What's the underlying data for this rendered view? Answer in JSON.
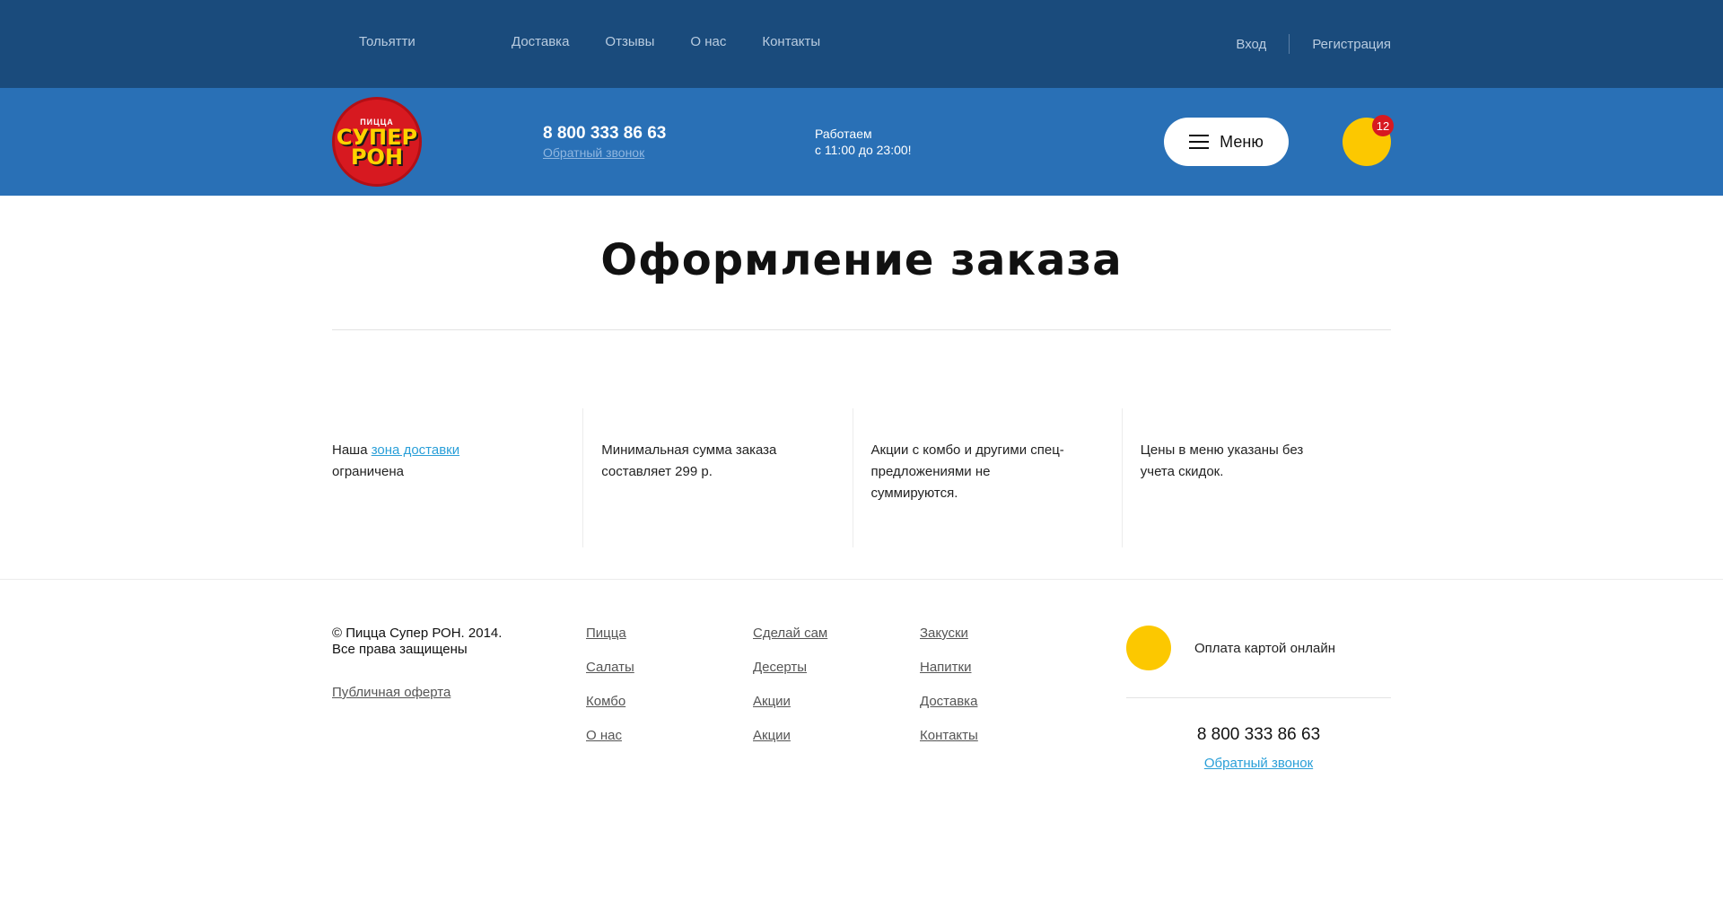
{
  "topbar": {
    "city": "Тольятти",
    "nav": [
      "Доставка",
      "Отзывы",
      "О нас",
      "Контакты"
    ],
    "login": "Вход",
    "register": "Регистрация"
  },
  "header": {
    "logo_small": "ПИЦЦА",
    "logo_big_1": "СУПЕР",
    "logo_big_2": "РОН",
    "phone": "8 800 333 86 63",
    "callback": "Обратный звонок",
    "hours_line1": "Работаем",
    "hours_line2": "с 11:00 до 23:00!",
    "menu_label": "Меню",
    "cart_count": "12"
  },
  "page": {
    "title": "Оформление заказа"
  },
  "info": {
    "col1_prefix": "Наша ",
    "col1_link": "зона доставки",
    "col1_suffix": " ограничена",
    "col2": "Минимальная сумма заказа составляет 299 р.",
    "col3": "Акции с комбо и другими спец-предложениями не суммируются.",
    "col4": "Цены в меню указаны без учета скидок."
  },
  "footer": {
    "copy_line1": "© Пицца Супер РОН. 2014.",
    "copy_line2": "Все права защищены",
    "offer": "Публичная оферта",
    "col1": [
      "Пицца",
      "Салаты",
      "Комбо",
      "О нас"
    ],
    "col2": [
      "Сделай сам",
      "Десерты",
      "Акции",
      "Акции"
    ],
    "col3": [
      "Закуски",
      "Напитки",
      "Доставка",
      "Контакты"
    ],
    "pay_label": "Оплата картой онлайн",
    "phone": "8 800 333 86 63",
    "callback": "Обратный звонок"
  },
  "colors": {
    "topbar_bg": "#1a4b7c",
    "header_bg": "#2970b6",
    "accent_yellow": "#fcc800",
    "badge_red": "#d71920",
    "link_blue": "#2a9fd8"
  }
}
